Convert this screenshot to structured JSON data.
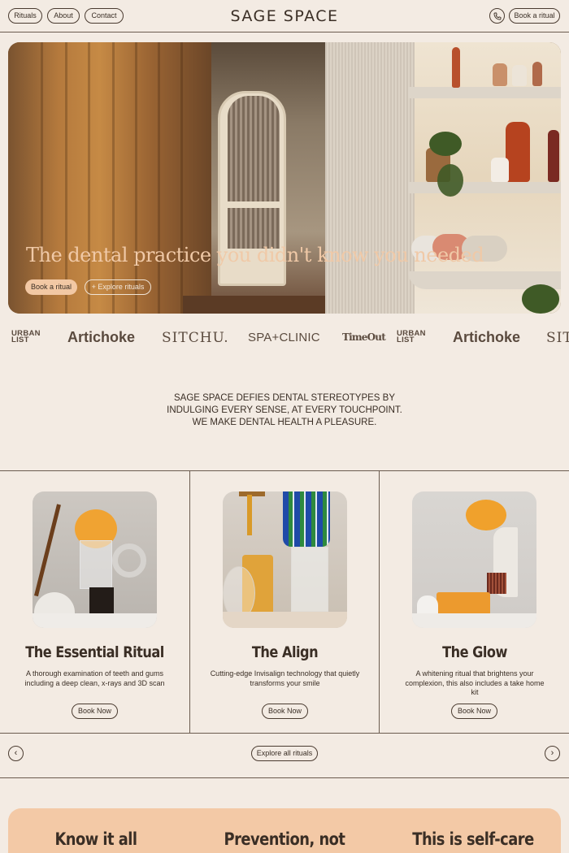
{
  "header": {
    "nav": [
      "Rituals",
      "About",
      "Contact"
    ],
    "logo": "SAGE SPACE",
    "phone_icon": "phone-icon",
    "book_label": "Book a ritual"
  },
  "hero": {
    "headline": "The dental practice you didn't know you needed",
    "book_label": "Book a ritual",
    "explore_label": "+ Explore rituals"
  },
  "press_logos": [
    "URBAN LIST",
    "Artichoke",
    "SITCHU.",
    "SPA+CLINIC",
    "TimeOut",
    "URBAN LIST",
    "Artichoke",
    "SIT"
  ],
  "intro": {
    "lines": [
      "SAGE SPACE DEFIES DENTAL STEREOTYPES BY",
      "INDULGING EVERY SENSE, AT EVERY TOUCHPOINT.",
      "WE MAKE DENTAL HEALTH A PLEASURE."
    ]
  },
  "rituals": [
    {
      "title": "The Essential Ritual",
      "description": "A thorough examination of teeth and gums including a deep clean, x-rays and 3D scan",
      "button": "Book Now"
    },
    {
      "title": "The Align",
      "description": "Cutting-edge Invisalign technology that quietly transforms your smile",
      "button": "Book Now"
    },
    {
      "title": "The Glow",
      "description": "A whitening ritual that brightens your complexion, this also includes a take home kit",
      "button": "Book Now"
    }
  ],
  "carousel": {
    "prev_icon": "arrow-left-icon",
    "next_icon": "arrow-right-icon",
    "prev_glyph": "‹",
    "next_glyph": "›",
    "explore_all": "Explore all rituals"
  },
  "features": [
    "Know it all",
    "Prevention, not",
    "This is self-care"
  ],
  "colors": {
    "background": "#f3ebe3",
    "text": "#3a2e25",
    "accent_peach": "#f2c8a4",
    "hero_headline": "#f0c9a7"
  }
}
